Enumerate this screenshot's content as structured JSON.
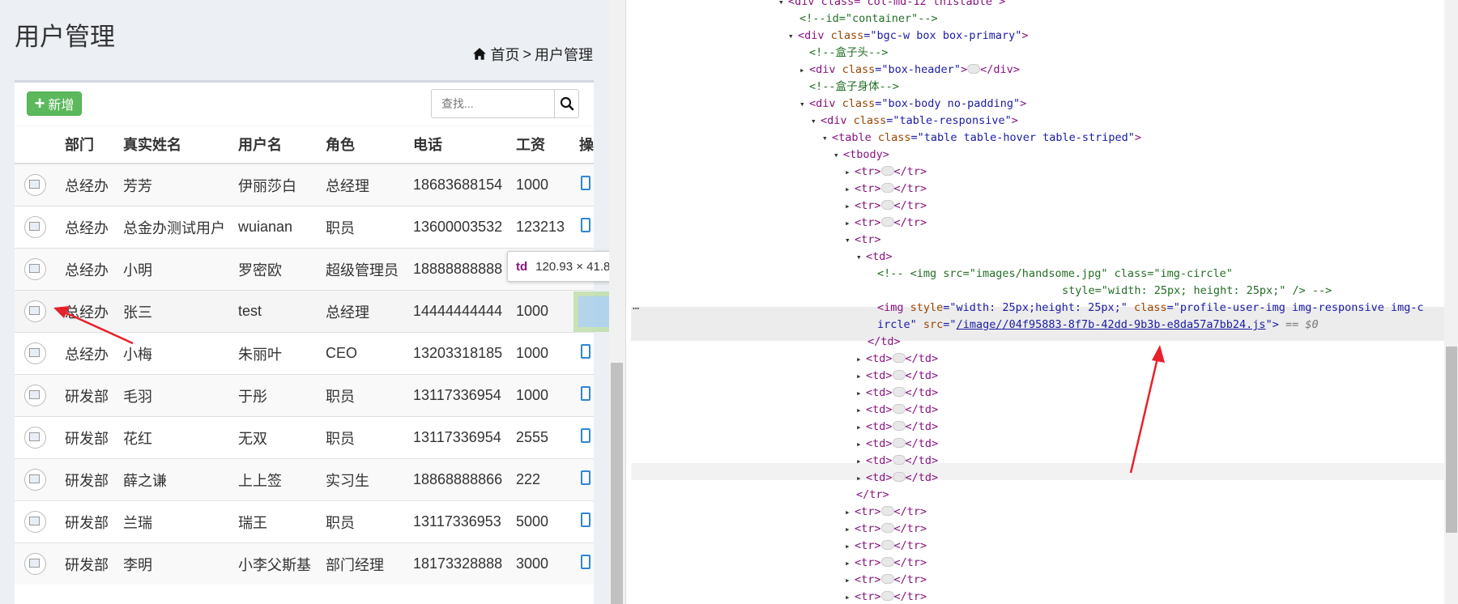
{
  "page": {
    "title": "用户管理",
    "breadcrumb": {
      "home": "首页",
      "sep": ">",
      "current": "用户管理"
    }
  },
  "toolbar": {
    "add_label": "新增",
    "search_placeholder": "查找..."
  },
  "table": {
    "columns": [
      "部门",
      "真实姓名",
      "用户名",
      "角色",
      "电话",
      "工资",
      "操"
    ],
    "rows": [
      [
        "总经办",
        "芳芳",
        "伊丽莎白",
        "总经理",
        "18683688154",
        "1000"
      ],
      [
        "总经办",
        "总金办测试用户",
        "wuianan",
        "职员",
        "13600003532",
        "123213"
      ],
      [
        "总经办",
        "小明",
        "罗密欧",
        "超级管理员",
        "18888888888",
        ""
      ],
      [
        "总经办",
        "张三",
        "test",
        "总经理",
        "14444444444",
        "1000"
      ],
      [
        "总经办",
        "小梅",
        "朱丽叶",
        "CEO",
        "13203318185",
        "1000"
      ],
      [
        "研发部",
        "毛羽",
        "于彤",
        "职员",
        "13117336954",
        "1000"
      ],
      [
        "研发部",
        "花红",
        "无双",
        "职员",
        "13117336954",
        "2555"
      ],
      [
        "研发部",
        "薛之谦",
        "上上签",
        "实习生",
        "18868888866",
        "222"
      ],
      [
        "研发部",
        "兰瑞",
        "瑞王",
        "职员",
        "13117336953",
        "5000"
      ],
      [
        "研发部",
        "李明",
        "小李父斯基",
        "部门经理",
        "18173328888",
        "3000"
      ]
    ]
  },
  "tooltip": {
    "tag": "td",
    "size": "120.93 × 41.8"
  },
  "devtools": {
    "l0": "<div class=\"col-md-12 thistable\">",
    "l1": "<!--id=\"container\"-->",
    "l2a": "<div ",
    "l2b": "class",
    "l2c": "=\"bgc-w box box-primary\"",
    "l2d": ">",
    "l3": "<!--盒子头-->",
    "l4a": "<div ",
    "l4b": "class",
    "l4c": "=\"box-header\"",
    "l4d": ">",
    "l4e": "</div>",
    "l5": "<!--盒子身体-->",
    "l6a": "<div ",
    "l6b": "class",
    "l6c": "=\"box-body no-padding\"",
    "l6d": ">",
    "l7a": "<div ",
    "l7b": "class",
    "l7c": "=\"table-responsive\"",
    "l7d": ">",
    "l8a": "<table ",
    "l8b": "class",
    "l8c": "=\"table table-hover table-striped\"",
    "l8d": ">",
    "l9": "<tbody>",
    "tr_open": "<tr>",
    "tr_close": "</tr>",
    "td_open": "<td>",
    "td_close": "</td>",
    "c1": "<!-- <img src=\"images/handsome.jpg\" class=\"img-circle\"",
    "c2": "style=\"width: 25px; height: 25px;\" /> -->",
    "img1a": "<img ",
    "img1b": "style",
    "img1c": "=\"width: 25px;height: 25px;\" ",
    "img1d": "class",
    "img1e": "=\"profile-user-img img-responsive img-c",
    "img2a": "ircle\" ",
    "img2b": "src",
    "img2c": "=\"",
    "img2d": "/image//04f95883-8f7b-42dd-9b3b-e8da57a7bb24.js",
    "img2e": "\">",
    "img2f": " == $0",
    "dots": "…"
  },
  "colors": {
    "accent": "#5cb85c",
    "arrow": "#e8202a",
    "link": "#2f86d6"
  }
}
